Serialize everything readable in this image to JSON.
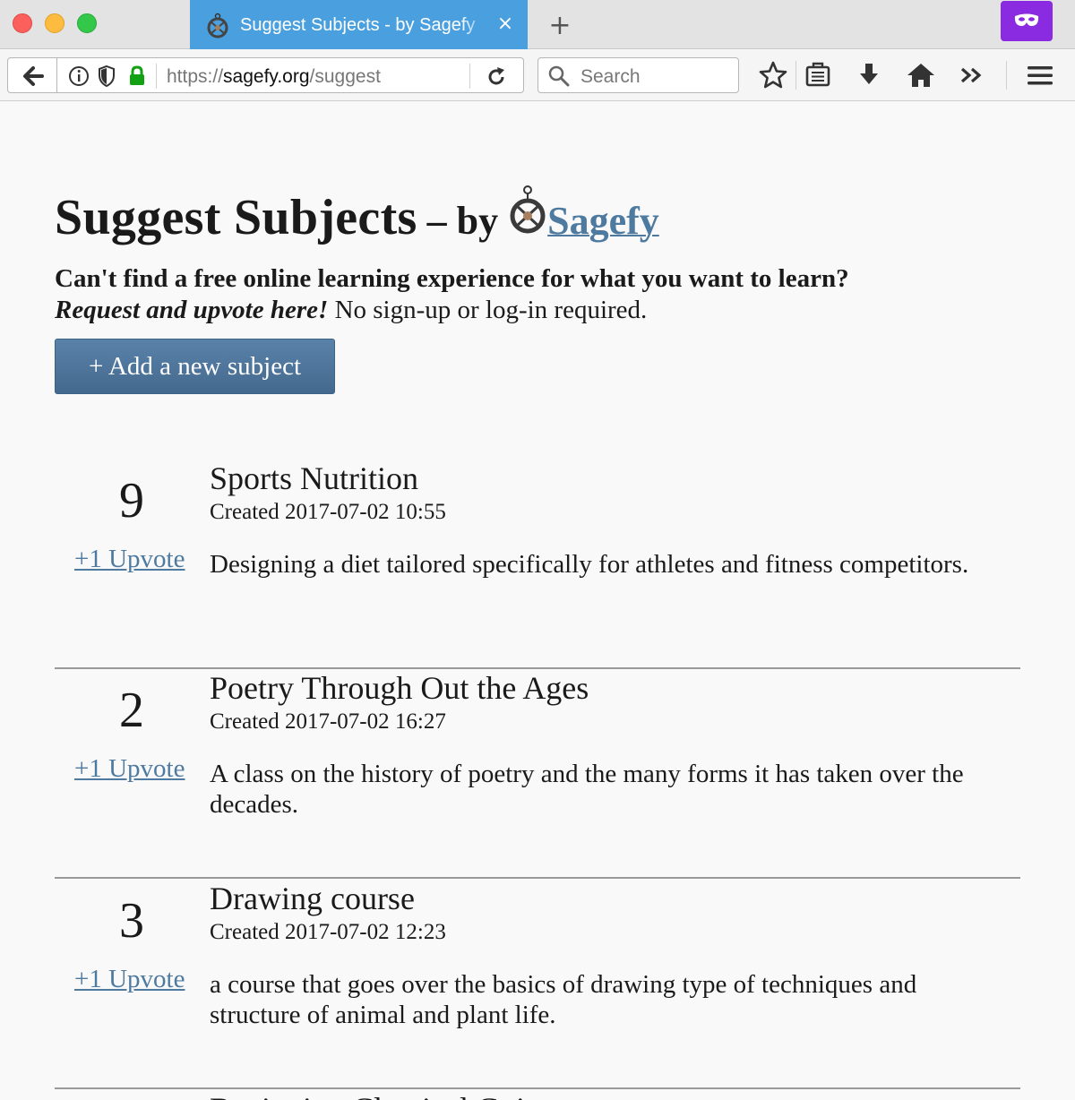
{
  "browser": {
    "tab": {
      "title": "Suggest Subjects - by Sagefy",
      "close": "×"
    },
    "new_tab": "+",
    "url": {
      "scheme": "https://",
      "host": "sagefy.org",
      "path": "/suggest"
    },
    "search": {
      "placeholder": "Search"
    }
  },
  "page": {
    "title": "Suggest Subjects",
    "by": " – by ",
    "brand": "Sagefy",
    "intro_question": "Can't find a free online learning experience for what you want to learn?",
    "intro_cta": "Request and upvote here!",
    "intro_note": " No sign-up or log-in required.",
    "add_button": "+ Add a new subject"
  },
  "subjects": [
    {
      "votes": "9",
      "upvote": "+1 Upvote",
      "title": "Sports Nutrition",
      "created": "Created 2017-07-02 10:55",
      "description": "Designing a diet tailored specifically for athletes and fitness competitors."
    },
    {
      "votes": "2",
      "upvote": "+1 Upvote",
      "title": "Poetry Through Out the Ages",
      "created": "Created 2017-07-02 16:27",
      "description": "A class on the history of poetry and the many forms it has taken over the decades."
    },
    {
      "votes": "3",
      "upvote": "+1 Upvote",
      "title": "Drawing course",
      "created": "Created 2017-07-02 12:23",
      "description": "a course that goes over the basics of drawing type of techniques and structure of animal and plant life."
    },
    {
      "title": "Beginning Classical Guitar"
    }
  ],
  "colors": {
    "link": "#4f7aa0",
    "button": "#4e7499",
    "tab_active": "#4a9fdf",
    "private_mask": "#8a2be2"
  }
}
